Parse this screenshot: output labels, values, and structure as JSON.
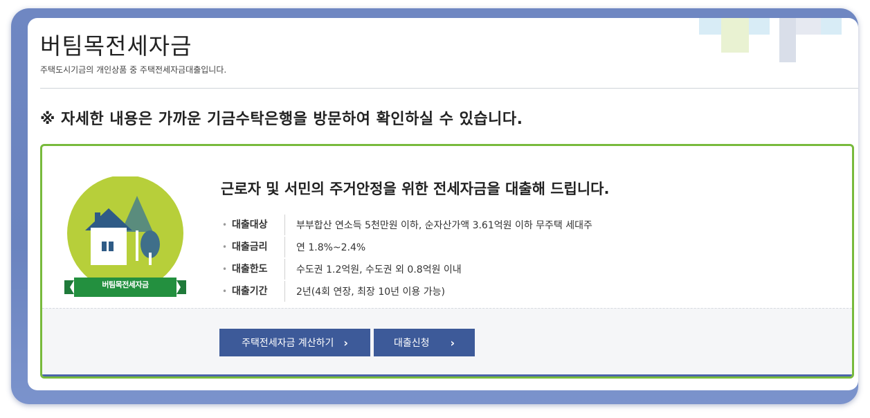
{
  "page": {
    "title": "버팀목전세자금",
    "subtitle": "주택도시기금의 개인상품 중 주택전세자금대출입니다."
  },
  "notice": "※ 자세한 내용은 가까운 기금수탁은행을 방문하여 확인하실 수 있습니다.",
  "product": {
    "emblem_label": "버팀목전세자금",
    "headline": "근로자 및 서민의 주거안정을 위한 전세자금을 대출해 드립니다.",
    "details": [
      {
        "key": "대출대상",
        "value": "부부합산 연소득 5천만원 이하, 순자산가액 3.61억원 이하 무주택 세대주"
      },
      {
        "key": "대출금리",
        "value": "연 1.8%~2.4%"
      },
      {
        "key": "대출한도",
        "value": "수도권 1.2억원, 수도권 외 0.8억원 이내"
      },
      {
        "key": "대출기간",
        "value": "2년(4회 연장, 최장 10년 이용 가능)"
      }
    ],
    "bullet": "•"
  },
  "buttons": {
    "calculator": {
      "label": "주택전세자금 계산하기",
      "chevron": "›"
    },
    "apply": {
      "label": "대출신청",
      "chevron": "›"
    }
  },
  "colors": {
    "frame": "#6f87c2",
    "card_border": "#78ba3c",
    "button": "#3d5a99",
    "emblem_circle": "#b7cf3a"
  },
  "icons": [
    "house-tree-emblem",
    "chevron-right-icon"
  ]
}
